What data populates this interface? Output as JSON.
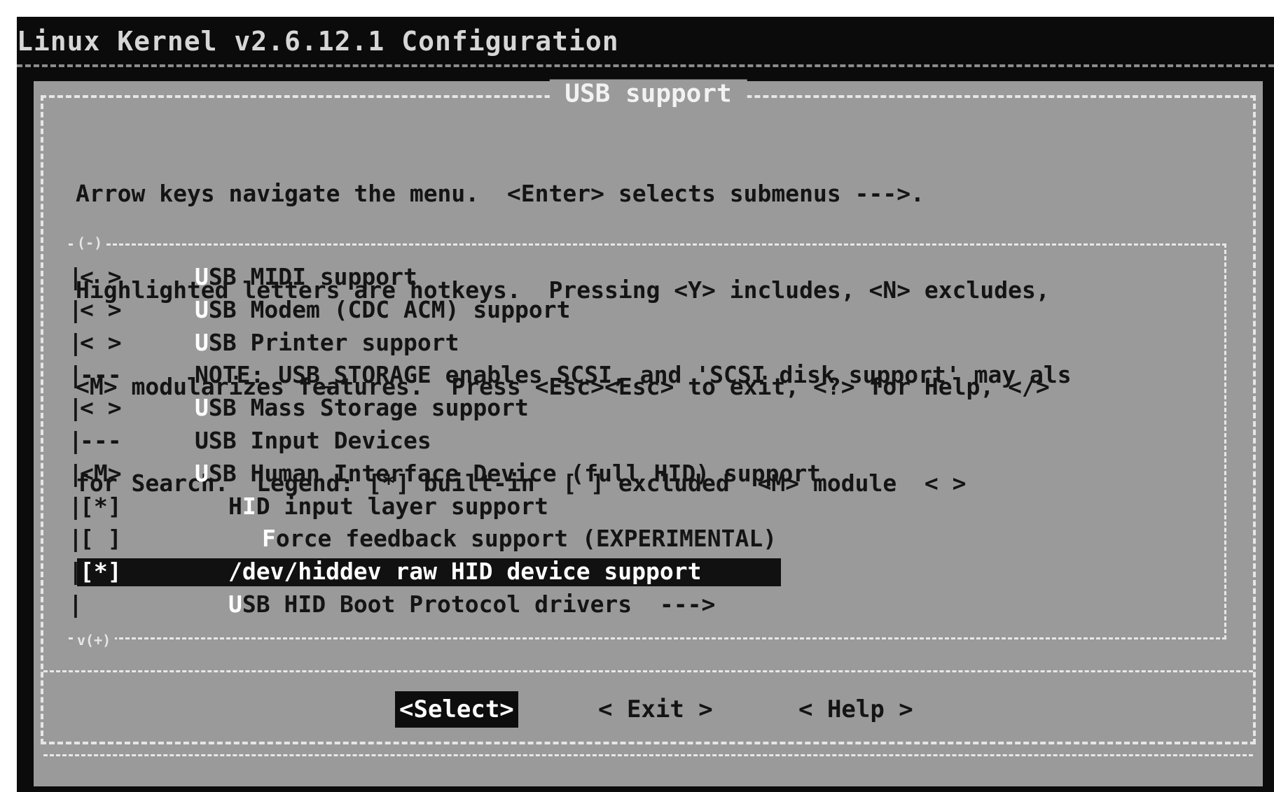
{
  "window": {
    "title": "Linux Kernel v2.6.12.1 Configuration"
  },
  "dialog": {
    "title": "USB support",
    "help_lines": [
      "Arrow keys navigate the menu.  <Enter> selects submenus --->.",
      "Highlighted letters are hotkeys.  Pressing <Y> includes, <N> excludes,",
      "<M> modularizes features.  Press <Esc><Esc> to exit, <?> for Help, </>",
      "for Search.  Legend: [*] built-in  [ ] excluded  <M> module  < >"
    ],
    "scroll_up": "(-)",
    "scroll_down": "v(+)"
  },
  "menu": {
    "items": [
      {
        "state": "< >",
        "hotkey": "U",
        "rest": "SB MIDI support"
      },
      {
        "state": "< >",
        "hotkey": "U",
        "rest": "SB Modem (CDC ACM) support"
      },
      {
        "state": "< >",
        "hotkey": "U",
        "rest": "SB Printer support"
      },
      {
        "state": "---",
        "hotkey": "",
        "rest": "NOTE: USB_STORAGE enables SCSI, and 'SCSI disk support' may als"
      },
      {
        "state": "< >",
        "hotkey": "U",
        "rest": "SB Mass Storage support"
      },
      {
        "state": "---",
        "hotkey": "",
        "rest": "USB Input Devices"
      },
      {
        "state": "<M>",
        "hotkey": "U",
        "rest": "SB Human Interface Device (full HID) support"
      },
      {
        "state": "[*]",
        "pre": "H",
        "hotkey": "I",
        "rest": "D input layer support"
      },
      {
        "state": "[ ]",
        "hotkey": "F",
        "rest": "orce feedback support (EXPERIMENTAL)"
      },
      {
        "state": "[*]",
        "hotkey": "",
        "rest": "/dev/hiddev raw HID device support"
      },
      {
        "state": "",
        "hotkey": "U",
        "rest": "SB HID Boot Protocol drivers  --->"
      }
    ],
    "selected_index": 9
  },
  "buttons": {
    "select": "<Select>",
    "exit": "< Exit >",
    "help": "< Help >"
  },
  "colors": {
    "screen_bg": "#0b0b0b",
    "dialog_bg": "#9a9a9a",
    "text": "#141414",
    "highlight_bg": "#111111",
    "highlight_text": "#ffffff"
  }
}
